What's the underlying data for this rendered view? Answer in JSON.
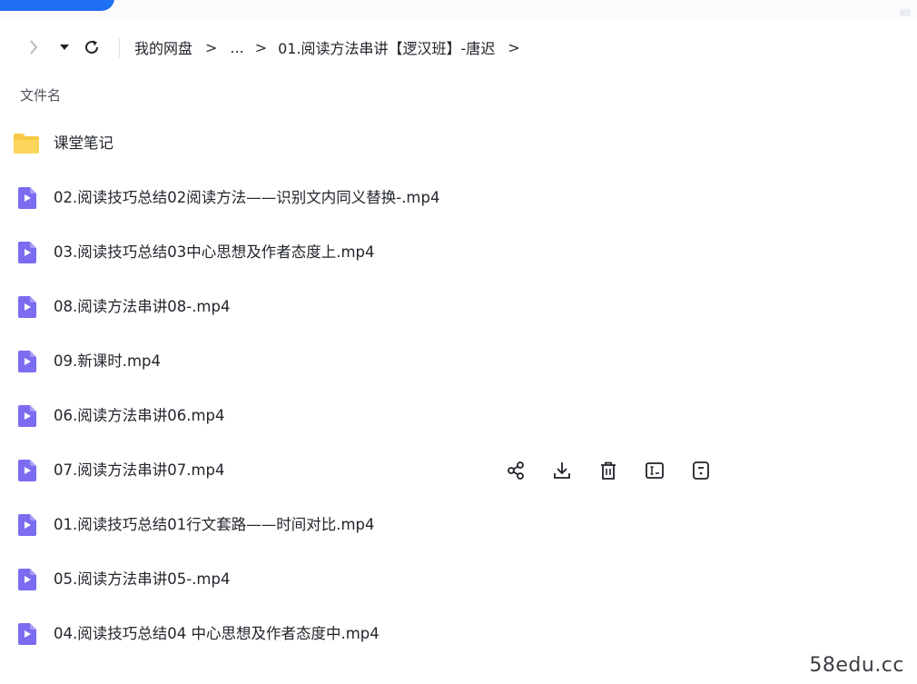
{
  "nav": {
    "back_icon": "chevron-left-icon",
    "dropdown_icon": "caret-down-icon",
    "refresh_icon": "refresh-icon",
    "breadcrumb": [
      {
        "label": "我的网盘"
      },
      {
        "label": "..."
      },
      {
        "label": "01.阅读方法串讲【逻汉班】-唐迟"
      }
    ],
    "separator": ">"
  },
  "list": {
    "column_header": "文件名",
    "items": [
      {
        "name": "课堂笔记",
        "type": "folder",
        "icon": "folder-icon"
      },
      {
        "name": "02.阅读技巧总结02阅读方法——识别文内同义替换-.mp4",
        "type": "video",
        "icon": "video-file-icon"
      },
      {
        "name": "03.阅读技巧总结03中心思想及作者态度上.mp4",
        "type": "video",
        "icon": "video-file-icon"
      },
      {
        "name": "08.阅读方法串讲08-.mp4",
        "type": "video",
        "icon": "video-file-icon"
      },
      {
        "name": "09.新课时.mp4",
        "type": "video",
        "icon": "video-file-icon"
      },
      {
        "name": "06.阅读方法串讲06.mp4",
        "type": "video",
        "icon": "video-file-icon"
      },
      {
        "name": "07.阅读方法串讲07.mp4",
        "type": "video",
        "icon": "video-file-icon",
        "hovered": true
      },
      {
        "name": "01.阅读技巧总结01行文套路——时间对比.mp4",
        "type": "video",
        "icon": "video-file-icon"
      },
      {
        "name": "05.阅读方法串讲05-.mp4",
        "type": "video",
        "icon": "video-file-icon"
      },
      {
        "name": "04.阅读技巧总结04 中心思想及作者态度中.mp4",
        "type": "video",
        "icon": "video-file-icon"
      }
    ],
    "row_actions": [
      "share-icon",
      "download-icon",
      "delete-icon",
      "rename-icon",
      "more-info-icon"
    ]
  },
  "colors": {
    "accent": "#1f6ff2",
    "folder": "#f7c945",
    "video_icon": "#7b6cf0"
  },
  "watermark": "58edu.cc"
}
